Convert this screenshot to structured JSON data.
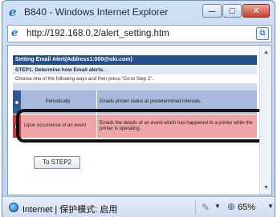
{
  "window": {
    "title": "B840 - Windows Internet Explorer",
    "minimize": "—",
    "maximize": "▢",
    "close": "✕"
  },
  "address": {
    "url": "http://192.168.0.2/alert_setting.htm"
  },
  "page": {
    "header": "Setting Email Alert(Address1:000@oki.com)",
    "step_title": "STEP1. Determine how Email alerts.",
    "step_desc": "Choose one of the following ways and then press \"Go to Step 2\".",
    "options": [
      {
        "label": "Periodically",
        "description": "Emails printer status at predetermined intervals."
      },
      {
        "label": "Upon occurrence of an event",
        "description": "Emails the details of an event which has happened to a printer while the printer is operating."
      }
    ],
    "next_button": "To STEP2"
  },
  "status": {
    "zone": "Internet | 保护模式: 启用",
    "zoom": "65%"
  },
  "icons": {
    "browser": "ie-logo-icon",
    "globe": "globe-icon",
    "zoom": "magnifier-icon"
  },
  "colors": {
    "header_bar": "#244f8c",
    "option_blue": "#a9b9de",
    "option_pink": "#f0a6a9",
    "highlight_border": "#111111"
  }
}
